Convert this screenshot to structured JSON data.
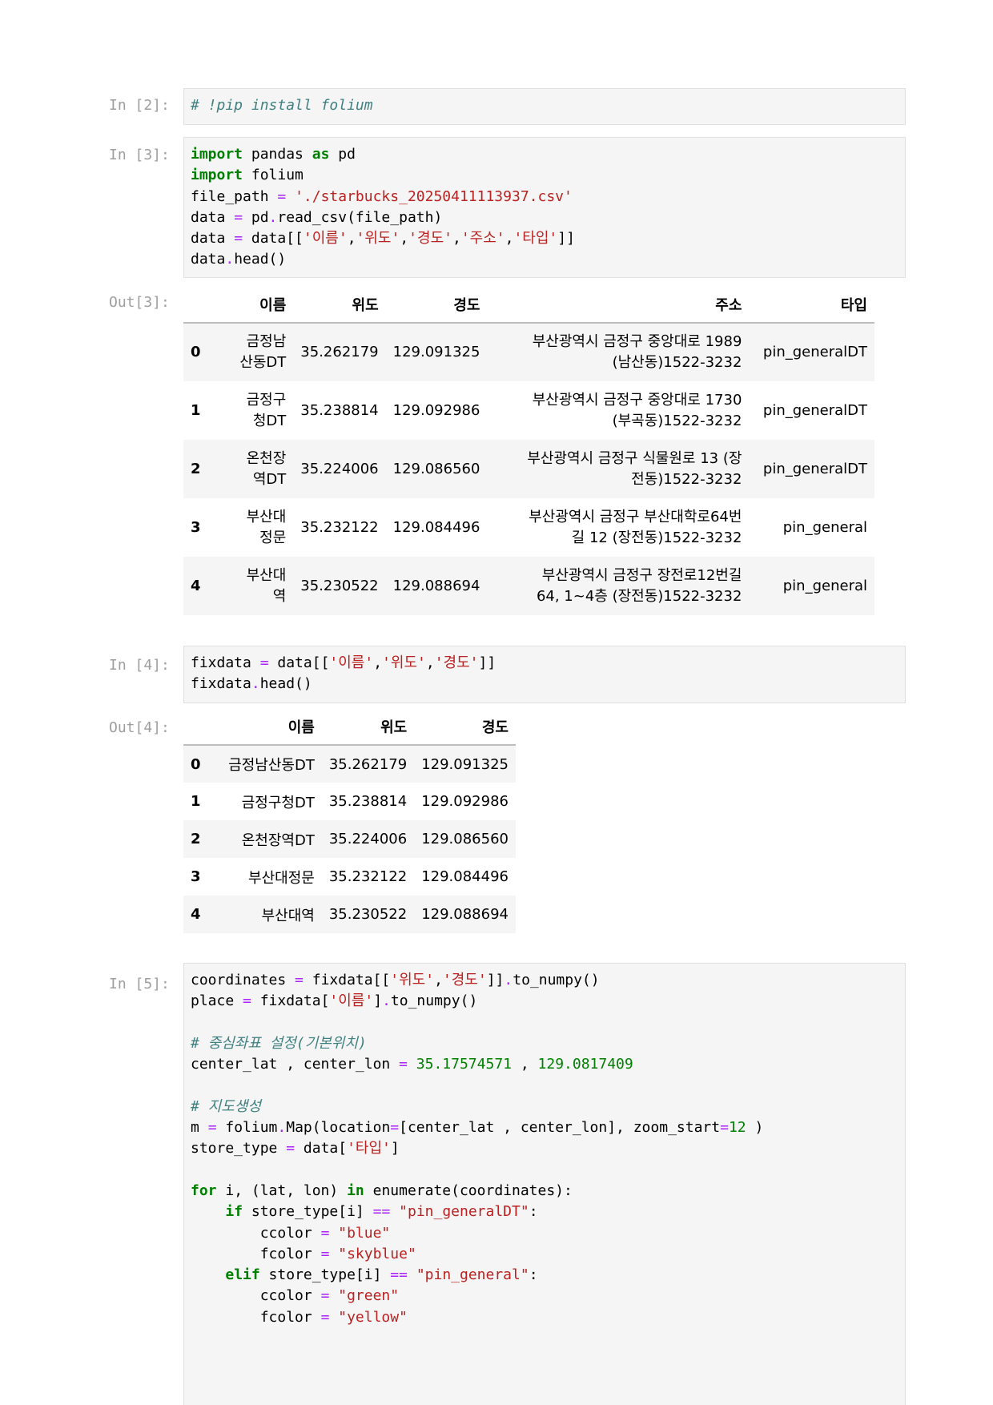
{
  "cells": [
    {
      "prompt": "In [2]:"
    },
    {
      "prompt": "In [3]:"
    },
    {
      "prompt": "Out[3]:"
    },
    {
      "prompt": "In [4]:"
    },
    {
      "prompt": "Out[4]:"
    },
    {
      "prompt": "In [5]:"
    }
  ],
  "code": {
    "c2": [
      [
        [
          "cm",
          "# !pip install folium"
        ]
      ]
    ],
    "c3": [
      [
        [
          "kw",
          "import"
        ],
        [
          "pl",
          " pandas "
        ],
        [
          "kw",
          "as"
        ],
        [
          "pl",
          " pd"
        ]
      ],
      [
        [
          "kw",
          "import"
        ],
        [
          "pl",
          " folium"
        ]
      ],
      [
        [
          "pl",
          "file_path "
        ],
        [
          "op",
          "="
        ],
        [
          "pl",
          " "
        ],
        [
          "str",
          "'./starbucks_20250411113937.csv'"
        ]
      ],
      [
        [
          "pl",
          "data "
        ],
        [
          "op",
          "="
        ],
        [
          "pl",
          " pd"
        ],
        [
          "op",
          "."
        ],
        [
          "pl",
          "read_csv(file_path)"
        ]
      ],
      [
        [
          "pl",
          "data "
        ],
        [
          "op",
          "="
        ],
        [
          "pl",
          " data[["
        ],
        [
          "str",
          "'이름'"
        ],
        [
          "pl",
          ","
        ],
        [
          "str",
          "'위도'"
        ],
        [
          "pl",
          ","
        ],
        [
          "str",
          "'경도'"
        ],
        [
          "pl",
          ","
        ],
        [
          "str",
          "'주소'"
        ],
        [
          "pl",
          ","
        ],
        [
          "str",
          "'타입'"
        ],
        [
          "pl",
          "]]"
        ]
      ],
      [
        [
          "pl",
          "data"
        ],
        [
          "op",
          "."
        ],
        [
          "pl",
          "head()"
        ]
      ]
    ],
    "c4": [
      [
        [
          "pl",
          "fixdata "
        ],
        [
          "op",
          "="
        ],
        [
          "pl",
          " data[["
        ],
        [
          "str",
          "'이름'"
        ],
        [
          "pl",
          ","
        ],
        [
          "str",
          "'위도'"
        ],
        [
          "pl",
          ","
        ],
        [
          "str",
          "'경도'"
        ],
        [
          "pl",
          "]]"
        ]
      ],
      [
        [
          "pl",
          "fixdata"
        ],
        [
          "op",
          "."
        ],
        [
          "pl",
          "head()"
        ]
      ]
    ],
    "c5": [
      [
        [
          "pl",
          "coordinates "
        ],
        [
          "op",
          "="
        ],
        [
          "pl",
          " fixdata[["
        ],
        [
          "str",
          "'위도'"
        ],
        [
          "pl",
          ","
        ],
        [
          "str",
          "'경도'"
        ],
        [
          "pl",
          "]]"
        ],
        [
          "op",
          "."
        ],
        [
          "pl",
          "to_numpy()"
        ]
      ],
      [
        [
          "pl",
          "place "
        ],
        [
          "op",
          "="
        ],
        [
          "pl",
          " fixdata["
        ],
        [
          "str",
          "'이름'"
        ],
        [
          "pl",
          "]"
        ],
        [
          "op",
          "."
        ],
        [
          "pl",
          "to_numpy()"
        ]
      ],
      [],
      [
        [
          "cm",
          "# 중심좌표 설정(기본위치)"
        ]
      ],
      [
        [
          "pl",
          "center_lat , center_lon "
        ],
        [
          "op",
          "="
        ],
        [
          "pl",
          " "
        ],
        [
          "num",
          "35.17574571"
        ],
        [
          "pl",
          " , "
        ],
        [
          "num",
          "129.0817409"
        ]
      ],
      [],
      [
        [
          "cm",
          "# 지도생성"
        ]
      ],
      [
        [
          "pl",
          "m "
        ],
        [
          "op",
          "="
        ],
        [
          "pl",
          " folium"
        ],
        [
          "op",
          "."
        ],
        [
          "pl",
          "Map(location"
        ],
        [
          "op",
          "="
        ],
        [
          "pl",
          "[center_lat , center_lon], zoom_start"
        ],
        [
          "op",
          "="
        ],
        [
          "num",
          "12"
        ],
        [
          "pl",
          " )"
        ]
      ],
      [
        [
          "pl",
          "store_type "
        ],
        [
          "op",
          "="
        ],
        [
          "pl",
          " data["
        ],
        [
          "str",
          "'타입'"
        ],
        [
          "pl",
          "]"
        ]
      ],
      [],
      [
        [
          "kw",
          "for"
        ],
        [
          "pl",
          " i, (lat, lon) "
        ],
        [
          "kw",
          "in"
        ],
        [
          "pl",
          " enumerate(coordinates):"
        ]
      ],
      [
        [
          "pl",
          "    "
        ],
        [
          "kw",
          "if"
        ],
        [
          "pl",
          " store_type[i] "
        ],
        [
          "op",
          "=="
        ],
        [
          "pl",
          " "
        ],
        [
          "str",
          "\"pin_generalDT\""
        ],
        [
          "pl",
          ":"
        ]
      ],
      [
        [
          "pl",
          "        ccolor "
        ],
        [
          "op",
          "="
        ],
        [
          "pl",
          " "
        ],
        [
          "str",
          "\"blue\""
        ]
      ],
      [
        [
          "pl",
          "        fcolor "
        ],
        [
          "op",
          "="
        ],
        [
          "pl",
          " "
        ],
        [
          "str",
          "\"skyblue\""
        ]
      ],
      [
        [
          "pl",
          "    "
        ],
        [
          "kw",
          "elif"
        ],
        [
          "pl",
          " store_type[i] "
        ],
        [
          "op",
          "=="
        ],
        [
          "pl",
          " "
        ],
        [
          "str",
          "\"pin_general\""
        ],
        [
          "pl",
          ":"
        ]
      ],
      [
        [
          "pl",
          "        ccolor "
        ],
        [
          "op",
          "="
        ],
        [
          "pl",
          " "
        ],
        [
          "str",
          "\"green\""
        ]
      ],
      [
        [
          "pl",
          "        fcolor "
        ],
        [
          "op",
          "="
        ],
        [
          "pl",
          " "
        ],
        [
          "str",
          "\"yellow\""
        ]
      ]
    ]
  },
  "table1": {
    "columns": [
      "",
      "이름",
      "위도",
      "경도",
      "주소",
      "타입"
    ],
    "rows": [
      {
        "index": "0",
        "name": [
          "금정남",
          "산동DT"
        ],
        "lat": "35.262179",
        "lon": "129.091325",
        "addr": [
          "부산광역시 금정구 중앙대로 1989",
          "(남산동)1522-3232"
        ],
        "type": "pin_generalDT"
      },
      {
        "index": "1",
        "name": [
          "금정구",
          "청DT"
        ],
        "lat": "35.238814",
        "lon": "129.092986",
        "addr": [
          "부산광역시 금정구 중앙대로 1730",
          "(부곡동)1522-3232"
        ],
        "type": "pin_generalDT"
      },
      {
        "index": "2",
        "name": [
          "온천장",
          "역DT"
        ],
        "lat": "35.224006",
        "lon": "129.086560",
        "addr": [
          "부산광역시 금정구 식물원로 13 (장",
          "전동)1522-3232"
        ],
        "type": "pin_generalDT"
      },
      {
        "index": "3",
        "name": [
          "부산대",
          "정문"
        ],
        "lat": "35.232122",
        "lon": "129.084496",
        "addr": [
          "부산광역시 금정구 부산대학로64번",
          "길 12 (장전동)1522-3232"
        ],
        "type": "pin_general"
      },
      {
        "index": "4",
        "name": [
          "부산대",
          "역"
        ],
        "lat": "35.230522",
        "lon": "129.088694",
        "addr": [
          "부산광역시 금정구 장전로12번길",
          "64, 1~4층 (장전동)1522-3232"
        ],
        "type": "pin_general"
      }
    ]
  },
  "table2": {
    "columns": [
      "",
      "이름",
      "위도",
      "경도"
    ],
    "rows": [
      {
        "index": "0",
        "name": "금정남산동DT",
        "lat": "35.262179",
        "lon": "129.091325"
      },
      {
        "index": "1",
        "name": "금정구청DT",
        "lat": "35.238814",
        "lon": "129.092986"
      },
      {
        "index": "2",
        "name": "온천장역DT",
        "lat": "35.224006",
        "lon": "129.086560"
      },
      {
        "index": "3",
        "name": "부산대정문",
        "lat": "35.232122",
        "lon": "129.084496"
      },
      {
        "index": "4",
        "name": "부산대역",
        "lat": "35.230522",
        "lon": "129.088694"
      }
    ]
  }
}
